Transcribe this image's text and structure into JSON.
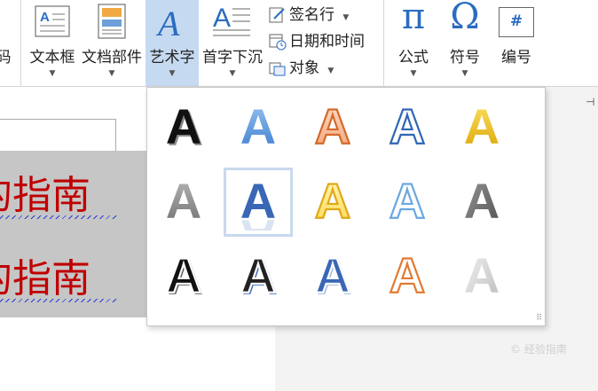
{
  "ribbon": {
    "partial_label": "码",
    "textbox_label": "文本框",
    "docparts_label": "文档部件",
    "wordart_label": "艺术字",
    "dropcap_label": "首字下沉",
    "signature_label": "签名行",
    "datetime_label": "日期和时间",
    "object_label": "对象",
    "formula_label": "公式",
    "symbol_label": "符号",
    "number_label": "编号",
    "pi_glyph": "π",
    "omega_glyph": "Ω",
    "hash_glyph": "#"
  },
  "document": {
    "line1": "的指南",
    "line2": "的指南",
    "text_color": "#c00000",
    "highlight_color": "#c6c6c6"
  },
  "gallery": {
    "letter": "A",
    "selected_index": 6,
    "styles": [
      "black-shadow",
      "blue-gradient",
      "orange-outline",
      "blue-outline",
      "gold-gradient",
      "gray-gradient",
      "blue-reflection",
      "yellow-outline",
      "light-blue-outline",
      "gray-bevel",
      "black-white-outline",
      "black-blue-outline",
      "blue-white-outline",
      "orange-white-outline",
      "silver-gradient"
    ]
  },
  "watermark": "© 经验指南",
  "colors": {
    "accent_blue": "#2b6cc0",
    "selected_tab": "#c5daf1"
  }
}
